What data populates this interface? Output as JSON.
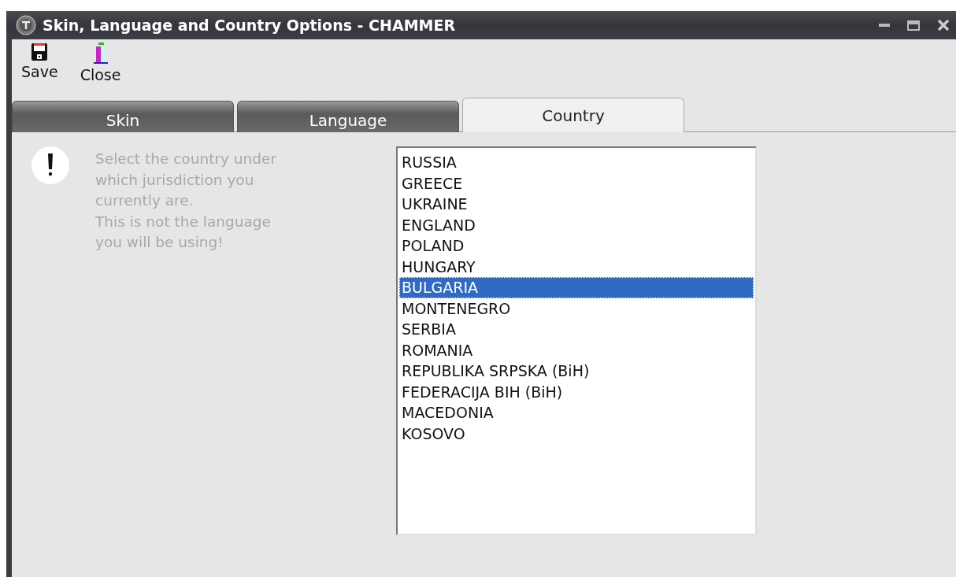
{
  "window": {
    "title": "Skin, Language and Country Options - CHAMMER"
  },
  "toolbar": [
    {
      "kind": "save",
      "label": "Save"
    },
    {
      "kind": "close",
      "label": "Close"
    }
  ],
  "tabs": [
    {
      "label": "Skin",
      "selected": false
    },
    {
      "label": "Language",
      "selected": false
    },
    {
      "label": "Country",
      "selected": true
    }
  ],
  "message_lines": [
    "Select the country under",
    "which jurisdiction you",
    "currently are.",
    "This is not the language",
    "you will be using!"
  ],
  "countries": [
    {
      "label": "RUSSIA",
      "selected": false
    },
    {
      "label": "GREECE",
      "selected": false
    },
    {
      "label": "UKRAINE",
      "selected": false
    },
    {
      "label": "ENGLAND",
      "selected": false
    },
    {
      "label": "POLAND",
      "selected": false
    },
    {
      "label": "HUNGARY",
      "selected": false
    },
    {
      "label": "BULGARIA",
      "selected": true
    },
    {
      "label": "MONTENEGRO",
      "selected": false
    },
    {
      "label": "SERBIA",
      "selected": false
    },
    {
      "label": "ROMANIA",
      "selected": false
    },
    {
      "label": "REPUBLIKA SRPSKA (BiH)",
      "selected": false
    },
    {
      "label": "FEDERACIJA BIH (BiH)",
      "selected": false
    },
    {
      "label": "MACEDONIA",
      "selected": false
    },
    {
      "label": "KOSOVO",
      "selected": false
    }
  ]
}
